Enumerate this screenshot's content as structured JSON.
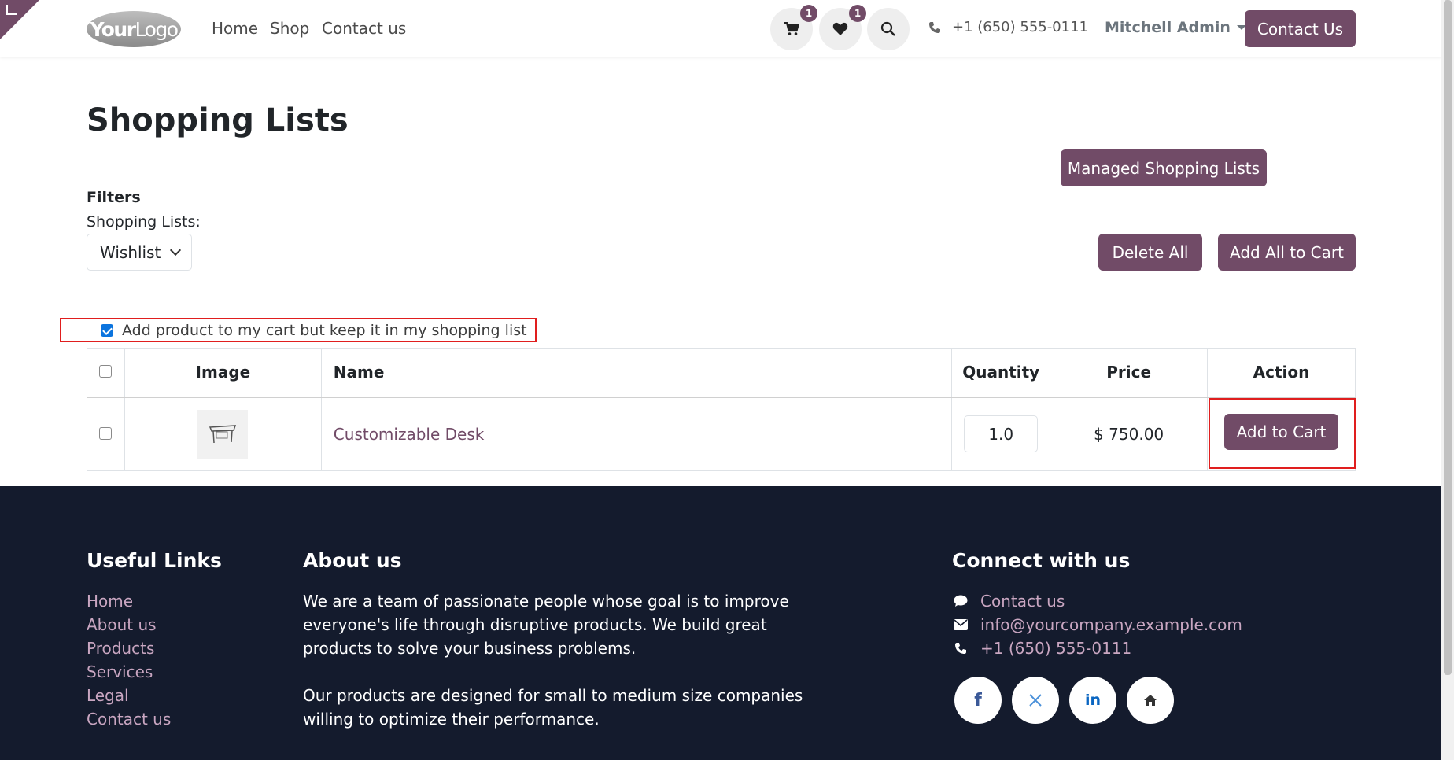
{
  "logo": {
    "text_bold": "Your",
    "text_thin": "Logo"
  },
  "nav": {
    "home": "Home",
    "shop": "Shop",
    "contact": "Contact us"
  },
  "header": {
    "cart_count": "1",
    "wishlist_count": "1",
    "phone": "+1 (650) 555-0111",
    "user": "Mitchell Admin",
    "contact_button": "Contact Us"
  },
  "page": {
    "title": "Shopping Lists",
    "filters_label": "Filters",
    "shopping_lists_label": "Shopping Lists:",
    "selected_list": "Wishlist",
    "managed_button": "Managed Shopping Lists",
    "delete_all": "Delete All",
    "add_all": "Add All to Cart",
    "keep_label": "Add product to my cart but keep it in my shopping list",
    "keep_checked": true
  },
  "table": {
    "headers": [
      "Image",
      "Name",
      "Quantity",
      "Price",
      "Action"
    ],
    "rows": [
      {
        "name": "Customizable Desk",
        "quantity": "1.0",
        "price": "$ 750.00",
        "action": "Add to Cart"
      }
    ]
  },
  "footer": {
    "useful_links_title": "Useful Links",
    "useful_links": [
      "Home",
      "About us",
      "Products",
      "Services",
      "Legal",
      "Contact us"
    ],
    "about_title": "About us",
    "about_p1": "We are a team of passionate people whose goal is to improve everyone's life through disruptive products. We build great products to solve your business problems.",
    "about_p2": "Our products are designed for small to medium size companies willing to optimize their performance.",
    "connect_title": "Connect with us",
    "contact_link": "Contact us",
    "email": "info@yourcompany.example.com",
    "phone": "+1 (650) 555-0111",
    "social": [
      "facebook-icon",
      "x-icon",
      "linkedin-icon",
      "home-icon"
    ]
  },
  "colors": {
    "brand": "#714b67",
    "footer_bg": "#141b2d",
    "highlight": "#e01e1e",
    "link": "#c9a6c1"
  }
}
